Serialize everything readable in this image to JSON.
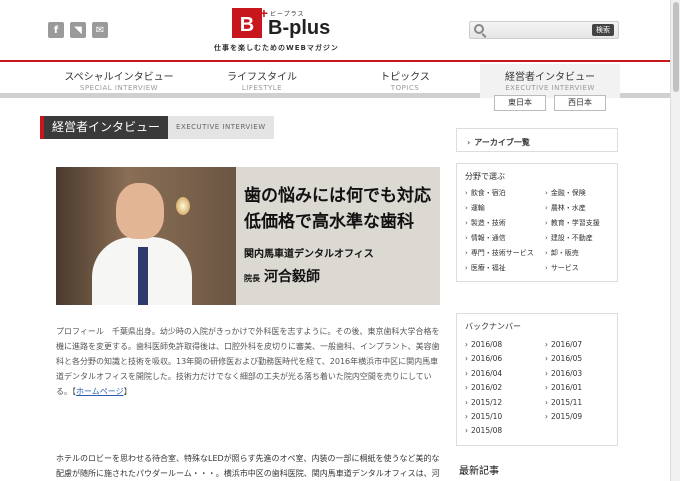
{
  "header": {
    "social": [
      {
        "glyph": "f",
        "icon": "facebook-icon"
      },
      {
        "glyph": "◥",
        "icon": "rss-icon"
      },
      {
        "glyph": "✉",
        "icon": "mail-icon"
      }
    ],
    "logo_letter": "B",
    "logo_plus": "+",
    "logo_kana": "ビープラス",
    "logo_name": "B-plus",
    "tagline": "仕事を楽しむためのWEBマガジン",
    "search_button": "検索"
  },
  "nav": [
    {
      "jp": "スペシャルインタビュー",
      "en": "SPECIAL INTERVIEW"
    },
    {
      "jp": "ライフスタイル",
      "en": "LIFESTYLE"
    },
    {
      "jp": "トピックス",
      "en": "TOPICS"
    },
    {
      "jp": "経営者インタビュー",
      "en": "EXECUTIVE INTERVIEW"
    }
  ],
  "subtabs": [
    "東日本",
    "西日本"
  ],
  "page_header": {
    "jp": "経営者インタビュー",
    "en": "EXECUTIVE INTERVIEW"
  },
  "hero": {
    "title_line1": "歯の悩みには何でも対応",
    "title_line2": "低価格で高水準な歯科",
    "clinic": "関内馬車道デンタルオフィス",
    "role": "院長",
    "person": "河合毅師"
  },
  "profile": {
    "text": "プロフィール　千葉県出身。幼少時の入院がきっかけで外科医を志すように。その後、東京歯科大学合格を機に進路を変更する。歯科医師免許取得後は、口腔外科を皮切りに審美、一般歯科、インプラント、美容歯科と各分野の知識と技術を吸収。13年間の研修医および勤務医時代を経て、2016年横浜市中区に関内馬車道デンタルオフィスを開院した。技術力だけでなく細部の工夫が光る落ち着いた院内空間を売りにしている。",
    "link_open": "【",
    "link_label": "ホームページ",
    "link_close": "】"
  },
  "body_text": "ホテルのロビーを思わせる待合室、特殊なLEDが照らす先進のオペ室、内装の一部に桐紙を使うなど美的な配慮が随所に施されたパウダールーム・・・。横浜市中区の歯科医院、関内馬車道デンタルオフィスは、河",
  "sidebar": {
    "archive_label": "アーカイブ一覧",
    "categories_title": "分野で選ぶ",
    "categories": [
      "飲食・宿泊",
      "金融・保険",
      "運輸",
      "農林・水産",
      "製造・技術",
      "教育・学習支援",
      "情報・通信",
      "建設・不動産",
      "専門・技術サービス",
      "卸・販売",
      "医療・福祉",
      "サービス"
    ],
    "back_title": "バックナンバー",
    "back_numbers": [
      "2016/08",
      "2016/07",
      "2016/06",
      "2016/05",
      "2016/04",
      "2016/03",
      "2016/02",
      "2016/01",
      "2015/12",
      "2015/11",
      "2015/10",
      "2015/09",
      "2015/08"
    ],
    "latest_title": "最新記事"
  },
  "colors": {
    "brand_red": "#c8161d",
    "dark_header": "#3a3a3a"
  }
}
